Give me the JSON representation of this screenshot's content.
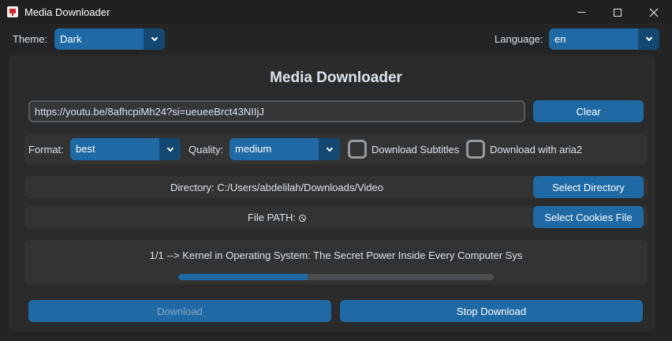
{
  "window": {
    "title": "Media Downloader"
  },
  "top_bar": {
    "theme_label": "Theme:",
    "theme_value": "Dark",
    "language_label": "Language:",
    "language_value": "en"
  },
  "main": {
    "heading": "Media Downloader",
    "url_value": "https://youtu.be/8afhcpiMh24?si=ueueeBrct43NIIjJ",
    "clear_label": "Clear",
    "format_label": "Format:",
    "format_value": "best",
    "quality_label": "Quality:",
    "quality_value": "medium",
    "subtitles_label": "Download Subtitles",
    "aria2_label": "Download with aria2",
    "directory_text": "Directory: C:/Users/abdelilah/Downloads/Video",
    "select_directory_label": "Select Directory",
    "file_path_text": "File PATH:",
    "select_cookies_label": "Select Cookies File",
    "status_text": "1/1 --> Kernel in Operating System: The Secret Power Inside Every Computer Sys",
    "progress": 0.41,
    "download_label": "Download",
    "stop_download_label": "Stop Download"
  },
  "colors": {
    "accent": "#1f6aa5",
    "accent_dark": "#144870",
    "background": "#242424",
    "panel": "#2b2b2b"
  }
}
